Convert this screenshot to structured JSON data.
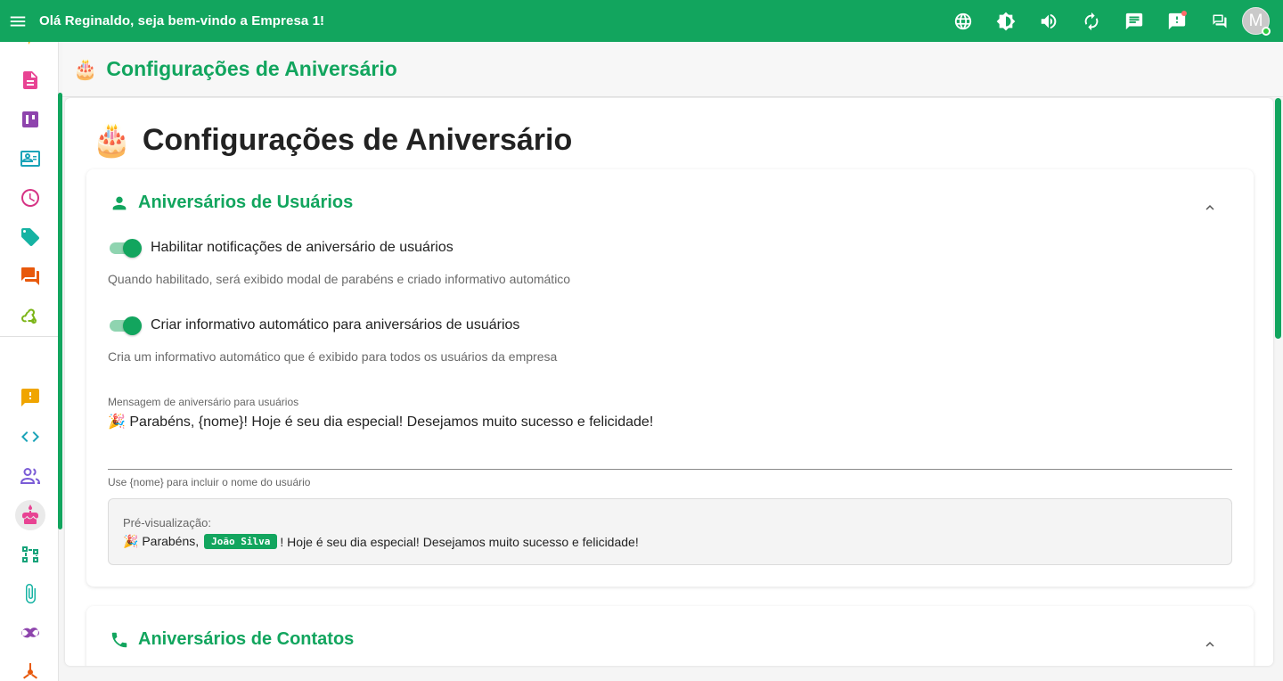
{
  "header": {
    "greeting": "Olá Reginaldo, seja bem-vindo a Empresa 1!",
    "avatar_initial": "M",
    "icons": [
      "globe-icon",
      "brightness-icon",
      "volume-icon",
      "refresh-icon",
      "chat-icon",
      "alert-icon",
      "forum-icon"
    ]
  },
  "sidebar": {
    "items": [
      {
        "icon": "document-icon",
        "color": "#e84393"
      },
      {
        "icon": "kanban-icon",
        "color": "#8e44ad"
      },
      {
        "icon": "contact-card-icon",
        "color": "#1aa3b8"
      },
      {
        "icon": "clock-icon",
        "color": "#d63384"
      },
      {
        "icon": "tag-icon",
        "color": "#16b3a3"
      },
      {
        "icon": "chat-bubbles-icon",
        "color": "#e8590c"
      },
      {
        "icon": "webhook-icon",
        "color": "#7cb518"
      },
      {
        "icon": "alert-box-icon",
        "color": "#f0a500"
      },
      {
        "icon": "code-icon",
        "color": "#1aa3b8"
      },
      {
        "icon": "users-icon",
        "color": "#7b5cd6"
      },
      {
        "icon": "cake-icon",
        "color": "#e84393"
      },
      {
        "icon": "flow-icon",
        "color": "#16a37a"
      },
      {
        "icon": "paperclip-icon",
        "color": "#16b3a3"
      },
      {
        "icon": "infinity-icon",
        "color": "#8e44ad"
      },
      {
        "icon": "hub-icon",
        "color": "#e8590c"
      }
    ]
  },
  "page": {
    "title": "Configurações de Aniversário",
    "heading": "Configurações de Aniversário"
  },
  "users_section": {
    "title": "Aniversários de Usuários",
    "toggle1_label": "Habilitar notificações de aniversário de usuários",
    "toggle1_helper": "Quando habilitado, será exibido modal de parabéns e criado informativo automático",
    "toggle2_label": "Criar informativo automático para aniversários de usuários",
    "toggle2_helper": "Cria um informativo automático que é exibido para todos os usuários da empresa",
    "message_label": "Mensagem de aniversário para usuários",
    "message_value": "🎉 Parabéns, {nome}! Hoje é seu dia especial! Desejamos muito sucesso e felicidade!",
    "message_helper": "Use {nome} para incluir o nome do usuário",
    "preview_label": "Pré-visualização:",
    "preview_prefix": "🎉 Parabéns,",
    "preview_name": "João Silva",
    "preview_suffix": "! Hoje é seu dia especial! Desejamos muito sucesso e felicidade!"
  },
  "contacts_section": {
    "title": "Aniversários de Contatos"
  }
}
